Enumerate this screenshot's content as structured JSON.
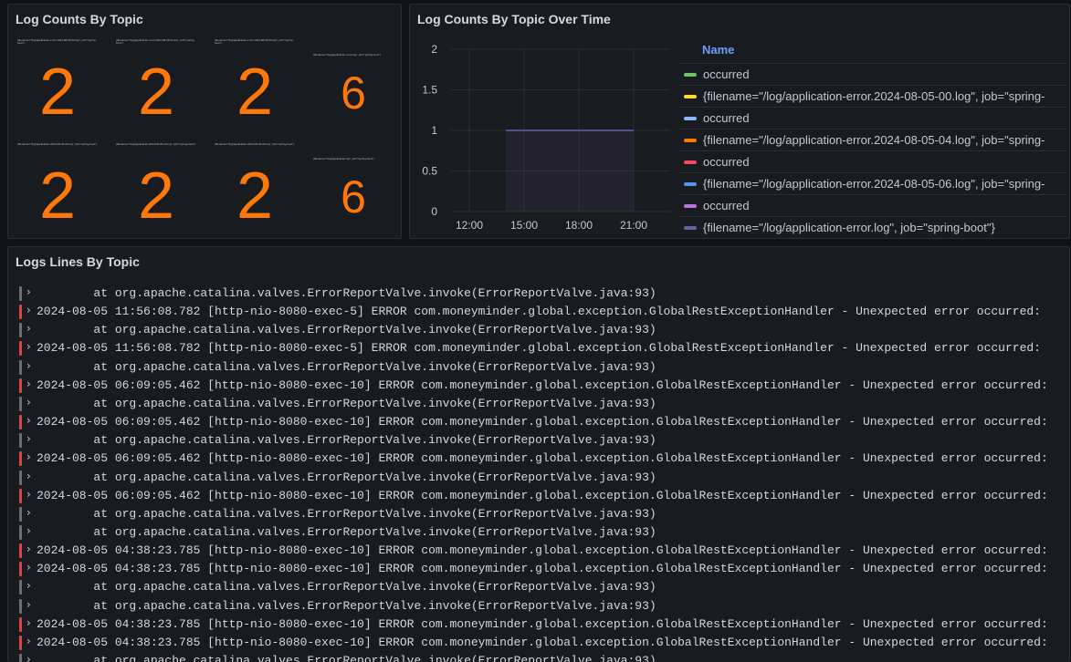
{
  "stat_panel": {
    "title": "Log Counts By Topic",
    "cells": [
      {
        "label": "{filename=\"/log/application-error.2024-08-05-00.log\", job=\"spring-boot\"}",
        "value": "2"
      },
      {
        "label": "{filename=\"/log/application-error.2024-08-05-04.log\", job=\"spring-boot\"}",
        "value": "2"
      },
      {
        "label": "{filename=\"/log/application-error.2024-08-05-06.log\", job=\"spring-boot\"}",
        "value": "2"
      },
      {
        "label": "{filename=\"/log/application-error.log\", job=\"spring-boot\"}",
        "value": "6"
      },
      {
        "label": "{filename=\"/log/application.2024-08-05-00.log\", job=\"spring-boot\"}",
        "value": "2"
      },
      {
        "label": "{filename=\"/log/application.2024-08-05-04.log\", job=\"spring-boot\"}",
        "value": "2"
      },
      {
        "label": "{filename=\"/log/application.2024-08-05-06.log\", job=\"spring-boot\"}",
        "value": "2"
      },
      {
        "label": "{filename=\"/log/application.log\", job=\"spring-boot\"}",
        "value": "6"
      }
    ]
  },
  "timeseries_panel": {
    "title": "Log Counts By Topic Over Time",
    "legend_header": "Name",
    "legend": [
      {
        "label": "occurred",
        "color": "#73bf69"
      },
      {
        "label": "{filename=\"/log/application-error.2024-08-05-00.log\", job=\"spring-",
        "color": "#fade2a"
      },
      {
        "label": "occurred",
        "color": "#8ab8ff"
      },
      {
        "label": "{filename=\"/log/application-error.2024-08-05-04.log\", job=\"spring-",
        "color": "#ff780a"
      },
      {
        "label": "occurred",
        "color": "#f2495c"
      },
      {
        "label": "{filename=\"/log/application-error.2024-08-05-06.log\", job=\"spring-",
        "color": "#5794f2"
      },
      {
        "label": "occurred",
        "color": "#b877d9"
      },
      {
        "label": "{filename=\"/log/application-error.log\", job=\"spring-boot\"}",
        "color": "#705da0"
      }
    ]
  },
  "chart_data": {
    "type": "area",
    "x_ticks": [
      "12:00",
      "15:00",
      "18:00",
      "21:00"
    ],
    "y_ticks": [
      "0",
      "0.5",
      "1",
      "1.5",
      "2"
    ],
    "ylim": [
      0,
      2
    ],
    "xlim_hours": [
      11,
      23
    ],
    "series": [
      {
        "x_start": "14:00",
        "x_end": "21:00",
        "value": 1,
        "color": "#705da0"
      }
    ],
    "grid": true
  },
  "logs_panel": {
    "title": "Logs Lines By Topic",
    "caret": "›",
    "lines": [
      {
        "level": "info",
        "text": "        at org.apache.catalina.valves.ErrorReportValve.invoke(ErrorReportValve.java:93)"
      },
      {
        "level": "error",
        "text": "2024-08-05 11:56:08.782 [http-nio-8080-exec-5] ERROR com.moneyminder.global.exception.GlobalRestExceptionHandler - Unexpected error occurred:"
      },
      {
        "level": "info",
        "text": "        at org.apache.catalina.valves.ErrorReportValve.invoke(ErrorReportValve.java:93)"
      },
      {
        "level": "error",
        "text": "2024-08-05 11:56:08.782 [http-nio-8080-exec-5] ERROR com.moneyminder.global.exception.GlobalRestExceptionHandler - Unexpected error occurred:"
      },
      {
        "level": "info",
        "text": "        at org.apache.catalina.valves.ErrorReportValve.invoke(ErrorReportValve.java:93)"
      },
      {
        "level": "error",
        "text": "2024-08-05 06:09:05.462 [http-nio-8080-exec-10] ERROR com.moneyminder.global.exception.GlobalRestExceptionHandler - Unexpected error occurred:"
      },
      {
        "level": "info",
        "text": "        at org.apache.catalina.valves.ErrorReportValve.invoke(ErrorReportValve.java:93)"
      },
      {
        "level": "error",
        "text": "2024-08-05 06:09:05.462 [http-nio-8080-exec-10] ERROR com.moneyminder.global.exception.GlobalRestExceptionHandler - Unexpected error occurred:"
      },
      {
        "level": "info",
        "text": "        at org.apache.catalina.valves.ErrorReportValve.invoke(ErrorReportValve.java:93)"
      },
      {
        "level": "error",
        "text": "2024-08-05 06:09:05.462 [http-nio-8080-exec-10] ERROR com.moneyminder.global.exception.GlobalRestExceptionHandler - Unexpected error occurred:"
      },
      {
        "level": "info",
        "text": "        at org.apache.catalina.valves.ErrorReportValve.invoke(ErrorReportValve.java:93)"
      },
      {
        "level": "error",
        "text": "2024-08-05 06:09:05.462 [http-nio-8080-exec-10] ERROR com.moneyminder.global.exception.GlobalRestExceptionHandler - Unexpected error occurred:"
      },
      {
        "level": "info",
        "text": "        at org.apache.catalina.valves.ErrorReportValve.invoke(ErrorReportValve.java:93)"
      },
      {
        "level": "info",
        "text": "        at org.apache.catalina.valves.ErrorReportValve.invoke(ErrorReportValve.java:93)"
      },
      {
        "level": "error",
        "text": "2024-08-05 04:38:23.785 [http-nio-8080-exec-10] ERROR com.moneyminder.global.exception.GlobalRestExceptionHandler - Unexpected error occurred:"
      },
      {
        "level": "error",
        "text": "2024-08-05 04:38:23.785 [http-nio-8080-exec-10] ERROR com.moneyminder.global.exception.GlobalRestExceptionHandler - Unexpected error occurred:"
      },
      {
        "level": "info",
        "text": "        at org.apache.catalina.valves.ErrorReportValve.invoke(ErrorReportValve.java:93)"
      },
      {
        "level": "info",
        "text": "        at org.apache.catalina.valves.ErrorReportValve.invoke(ErrorReportValve.java:93)"
      },
      {
        "level": "error",
        "text": "2024-08-05 04:38:23.785 [http-nio-8080-exec-10] ERROR com.moneyminder.global.exception.GlobalRestExceptionHandler - Unexpected error occurred:"
      },
      {
        "level": "error",
        "text": "2024-08-05 04:38:23.785 [http-nio-8080-exec-10] ERROR com.moneyminder.global.exception.GlobalRestExceptionHandler - Unexpected error occurred:"
      },
      {
        "level": "info",
        "text": "        at org.apache.catalina.valves.ErrorReportValve.invoke(ErrorReportValve.java:93)"
      }
    ]
  },
  "colors": {
    "error_bar": "#e0424a",
    "info_bar": "#6e6e78",
    "stat_value": "#ff780a"
  }
}
